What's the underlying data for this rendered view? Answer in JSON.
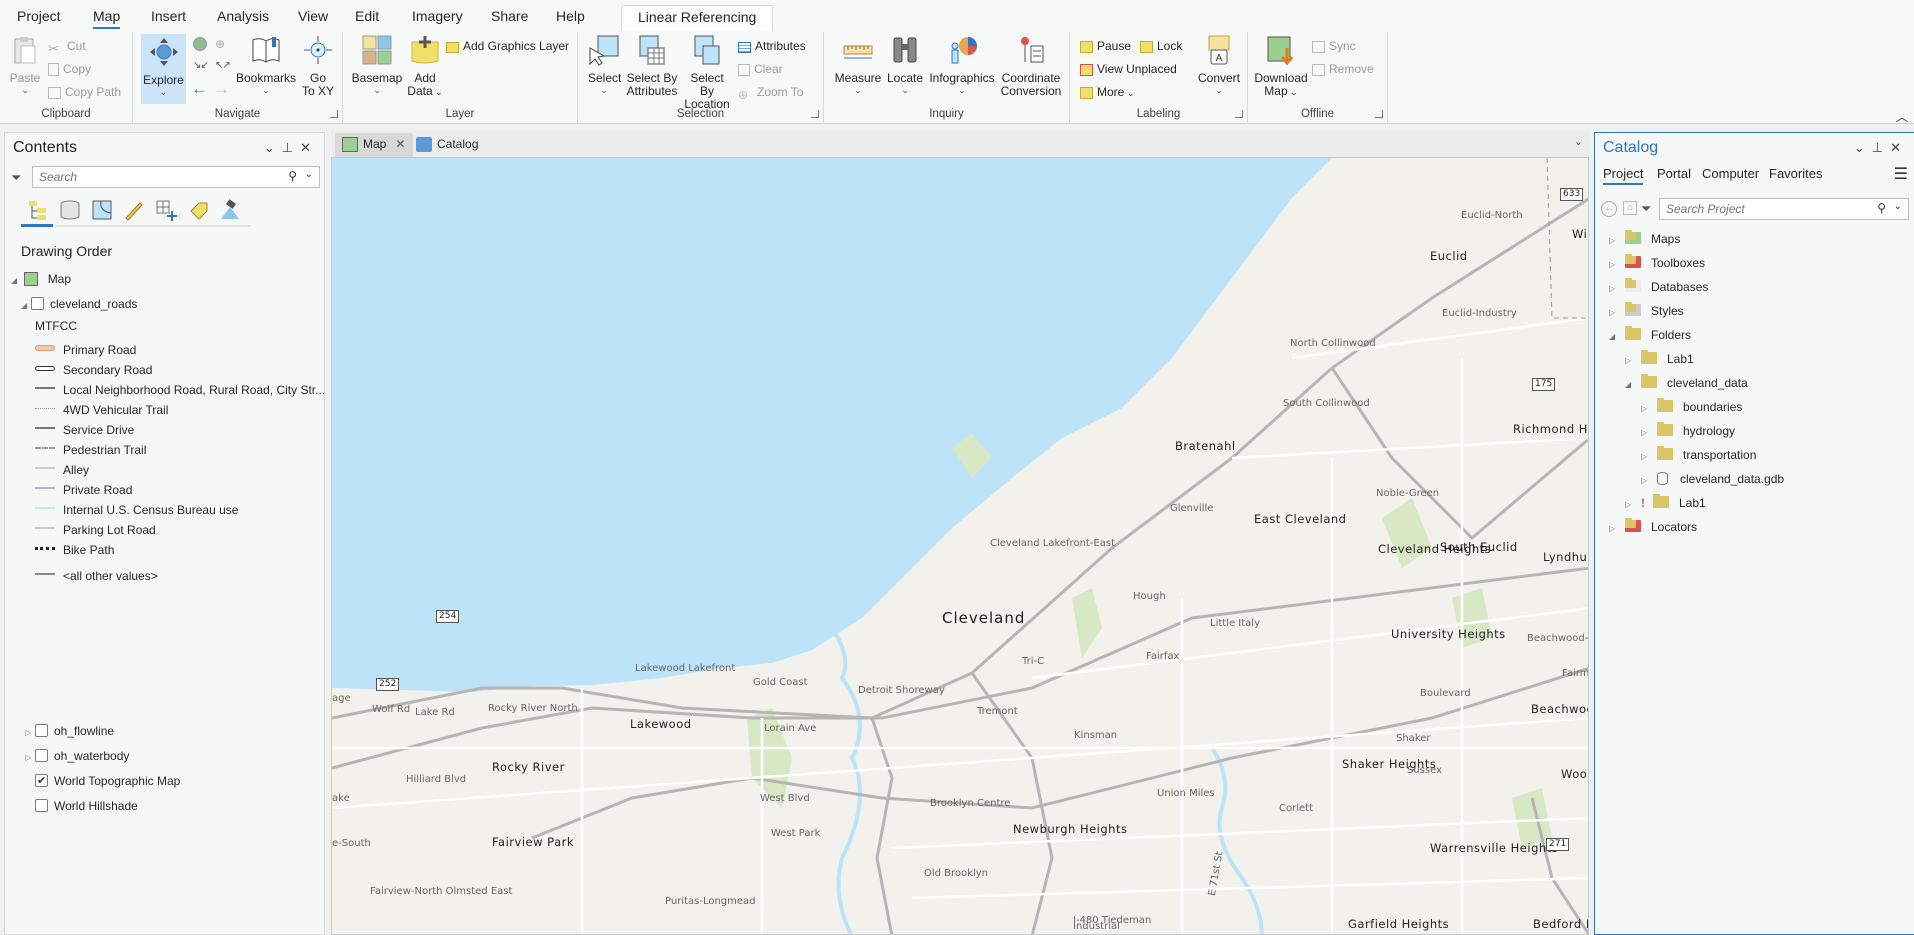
{
  "ribbon_tabs": [
    "Project",
    "Map",
    "Insert",
    "Analysis",
    "View",
    "Edit",
    "Imagery",
    "Share",
    "Help"
  ],
  "active_tab": "Map",
  "contextual_tab": "Linear Referencing",
  "ribbon": {
    "clipboard": {
      "label": "Clipboard",
      "paste": "Paste",
      "cut": "Cut",
      "copy": "Copy",
      "copy_path": "Copy Path"
    },
    "navigate": {
      "label": "Navigate",
      "explore": "Explore",
      "bookmarks": "Bookmarks",
      "goto_xy_1": "Go",
      "goto_xy_2": "To XY"
    },
    "layer": {
      "label": "Layer",
      "basemap": "Basemap",
      "add_data_1": "Add",
      "add_data_2": "Data",
      "add_graphics_layer": "Add Graphics Layer"
    },
    "selection": {
      "label": "Selection",
      "select": "Select",
      "select_by_attributes_1": "Select By",
      "select_by_attributes_2": "Attributes",
      "select_by_location_1": "Select By",
      "select_by_location_2": "Location",
      "attributes": "Attributes",
      "clear": "Clear",
      "zoom_to": "Zoom To"
    },
    "inquiry": {
      "label": "Inquiry",
      "measure": "Measure",
      "locate": "Locate",
      "infographics": "Infographics",
      "coordinate_1": "Coordinate",
      "coordinate_2": "Conversion"
    },
    "labeling": {
      "label": "Labeling",
      "pause": "Pause",
      "lock": "Lock",
      "view_unplaced": "View Unplaced",
      "more": "More",
      "convert": "Convert"
    },
    "offline": {
      "label": "Offline",
      "download_1": "Download",
      "download_2": "Map",
      "sync": "Sync",
      "remove": "Remove"
    }
  },
  "contents": {
    "title": "Contents",
    "search_placeholder": "Search",
    "heading": "Drawing Order",
    "map_name": "Map",
    "layers": [
      {
        "name": "cleveland_roads",
        "checked": false,
        "expanded": true
      },
      {
        "name": "oh_flowline",
        "checked": false,
        "expanded": false
      },
      {
        "name": "oh_waterbody",
        "checked": false,
        "expanded": false
      },
      {
        "name": "World Topographic Map",
        "checked": true
      },
      {
        "name": "World Hillshade",
        "checked": false
      }
    ],
    "legend_field": "MTFCC",
    "legend": [
      {
        "label": "Primary Road",
        "color": "#f2b89a"
      },
      {
        "label": "Secondary Road",
        "color": "#444444"
      },
      {
        "label": "Local Neighborhood Road, Rural Road, City Str...",
        "color": "#777777"
      },
      {
        "label": "4WD Vehicular Trail",
        "color": "#aaaaaa"
      },
      {
        "label": "Service Drive",
        "color": "#777777"
      },
      {
        "label": "Pedestrian Trail",
        "color": "#999999"
      },
      {
        "label": "Alley",
        "color": "#cccccc"
      },
      {
        "label": "Private Road",
        "color": "#b4aef0"
      },
      {
        "label": "Internal U.S. Census Bureau use",
        "color": "#b7f2d2"
      },
      {
        "label": "Parking Lot Road",
        "color": "#cccccc"
      },
      {
        "label": "Bike Path",
        "color": "#222222"
      },
      {
        "label": "<all other values>",
        "color": "#888888"
      }
    ]
  },
  "view_tabs": [
    {
      "label": "Map",
      "active": true,
      "closable": true
    },
    {
      "label": "Catalog",
      "active": false
    }
  ],
  "map_labels": {
    "big": [
      "Cleveland"
    ],
    "cities": [
      "Euclid",
      "Bratenahl",
      "East Cleveland",
      "Cleveland Heights",
      "South Euclid",
      "Lyndhur",
      "University Heights",
      "Beachwood",
      "Shaker Heights",
      "Warrensville Heights",
      "Lakewood",
      "Rocky River",
      "Fairview Park",
      "Newburgh Heights",
      "Richmond Heights",
      "Garfield Heights",
      "Bedford Heights",
      "Woo",
      "Wi"
    ],
    "neighborhoods": [
      "Euclid-North",
      "Euclid-Industry",
      "North Collinwood",
      "South Collinwood",
      "Noble-Green",
      "Glenville",
      "Cleveland Lakefront-East",
      "Hough",
      "Little Italy",
      "Fairfax",
      "Tri-C",
      "Lakewood Lakefront",
      "Gold Coast",
      "Detroit Shoreway",
      "Tremont",
      "Kinsman",
      "Boulevard",
      "Shaker",
      "Sussex",
      "Union Miles",
      "Corlett",
      "Brooklyn Centre",
      "Old Brooklyn",
      "West Park",
      "Puritas-Longmead",
      "Fairview-North Olmsted East",
      "Rocky River North",
      "Beachwood-Lander",
      "Industrial",
      "I-480 Tiedeman",
      "age",
      "ake",
      "e-South"
    ],
    "roads": [
      "Wolf Rd",
      "Lake Rd",
      "Hilliard Blvd",
      "Lorain Ave",
      "West Blvd",
      "Fairmount Blvd",
      "E 71st St"
    ],
    "shields": [
      "633",
      "175",
      "254",
      "252",
      "271"
    ]
  },
  "catalog": {
    "title": "Catalog",
    "tabs": [
      "Project",
      "Portal",
      "Computer",
      "Favorites"
    ],
    "active_tab": "Project",
    "search_placeholder": "Search Project",
    "tree": [
      {
        "label": "Maps",
        "level": 0,
        "expanded": false
      },
      {
        "label": "Toolboxes",
        "level": 0,
        "expanded": false
      },
      {
        "label": "Databases",
        "level": 0,
        "expanded": false
      },
      {
        "label": "Styles",
        "level": 0,
        "expanded": false
      },
      {
        "label": "Folders",
        "level": 0,
        "expanded": true
      },
      {
        "label": "Lab1",
        "level": 1,
        "expanded": false
      },
      {
        "label": "cleveland_data",
        "level": 1,
        "expanded": true
      },
      {
        "label": "boundaries",
        "level": 2,
        "expanded": false
      },
      {
        "label": "hydrology",
        "level": 2,
        "expanded": false
      },
      {
        "label": "transportation",
        "level": 2,
        "expanded": false
      },
      {
        "label": "cleveland_data.gdb",
        "level": 2,
        "expanded": false
      },
      {
        "label": "Lab1",
        "level": 1,
        "expanded": false,
        "warning": true
      },
      {
        "label": "Locators",
        "level": 0,
        "expanded": false
      }
    ]
  },
  "colors": {
    "accent": "#2f76c6",
    "water": "#bde3f9",
    "land": "#f2f1ec",
    "park": "#d9e8c4"
  }
}
